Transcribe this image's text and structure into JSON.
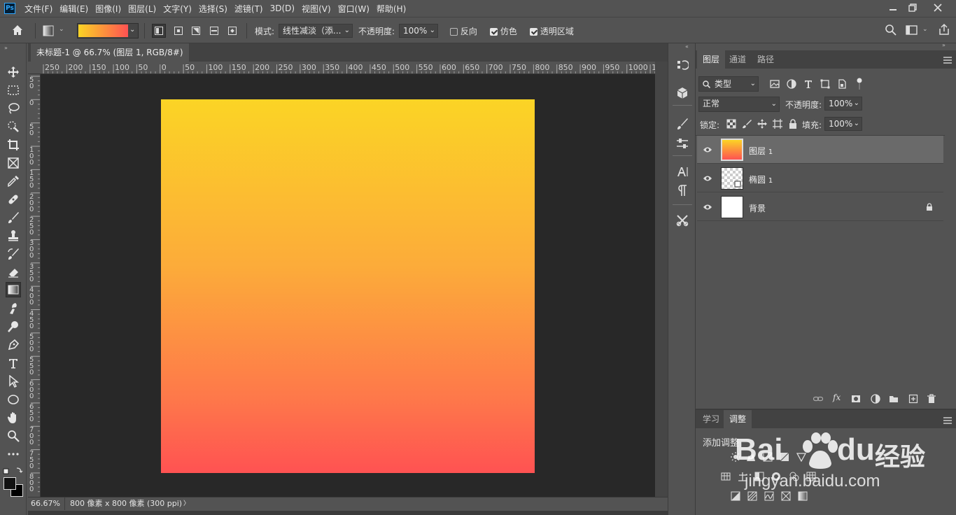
{
  "app": {
    "logo": "Ps"
  },
  "menu": [
    "文件(F)",
    "编辑(E)",
    "图像(I)",
    "图层(L)",
    "文字(Y)",
    "选择(S)",
    "滤镜(T)",
    "3D(D)",
    "视图(V)",
    "窗口(W)",
    "帮助(H)"
  ],
  "options": {
    "mode_label": "模式:",
    "mode_value": "线性减淡（添...",
    "opacity_label": "不透明度:",
    "opacity_value": "100%",
    "reverse_label": "反向",
    "dither_label": "仿色",
    "transparency_label": "透明区域",
    "gradient_colors": [
      "#fbd425",
      "#ff5252"
    ]
  },
  "document": {
    "tab_title": "未标题-1 @ 66.7% (图层 1, RGB/8#) *",
    "close_glyph": "×",
    "ruler_top_labels": [
      "250",
      "200",
      "150",
      "100",
      "50",
      "0",
      "50",
      "100",
      "150",
      "200",
      "250",
      "300",
      "350",
      "400",
      "450",
      "500",
      "550",
      "600",
      "650",
      "700",
      "750",
      "800",
      "850",
      "900",
      "950",
      "1000",
      "1"
    ],
    "ruler_left_labels": [
      "5\n0",
      "0",
      "5\n0",
      "1\n0\n0",
      "1\n5\n0",
      "2\n0\n0",
      "2\n5\n0",
      "3\n0\n0",
      "3\n5\n0",
      "4\n0\n0",
      "4\n5\n0",
      "5\n0\n0",
      "5\n5\n0",
      "6\n0\n0",
      "6\n5\n0",
      "7\n0\n0",
      "7\n5\n0",
      "8\n0\n0"
    ],
    "gradient_top": "#fbd425",
    "gradient_bottom": "#ff5252"
  },
  "status": {
    "zoom": "66.67%",
    "info": "800 像素 x 800 像素 (300 ppi)",
    "arrow": "〉"
  },
  "layers_panel": {
    "tabs": [
      "图层",
      "通道",
      "路径"
    ],
    "filter_label": "类型",
    "blend_mode": "正常",
    "opacity_label": "不透明度:",
    "opacity_value": "100%",
    "lock_label": "锁定:",
    "fill_label": "填充:",
    "fill_value": "100%",
    "layers": [
      {
        "name": "图层",
        "num": "1"
      },
      {
        "name": "椭圆",
        "num": "1"
      },
      {
        "name": "背景",
        "num": ""
      }
    ]
  },
  "adjust_panel": {
    "tabs": [
      "学习",
      "调整"
    ],
    "add_label": "添加调整"
  },
  "watermark": {
    "brand": "Bai",
    "brand2": "du",
    "cn": "经验",
    "url": "jingyan.baidu.com"
  }
}
